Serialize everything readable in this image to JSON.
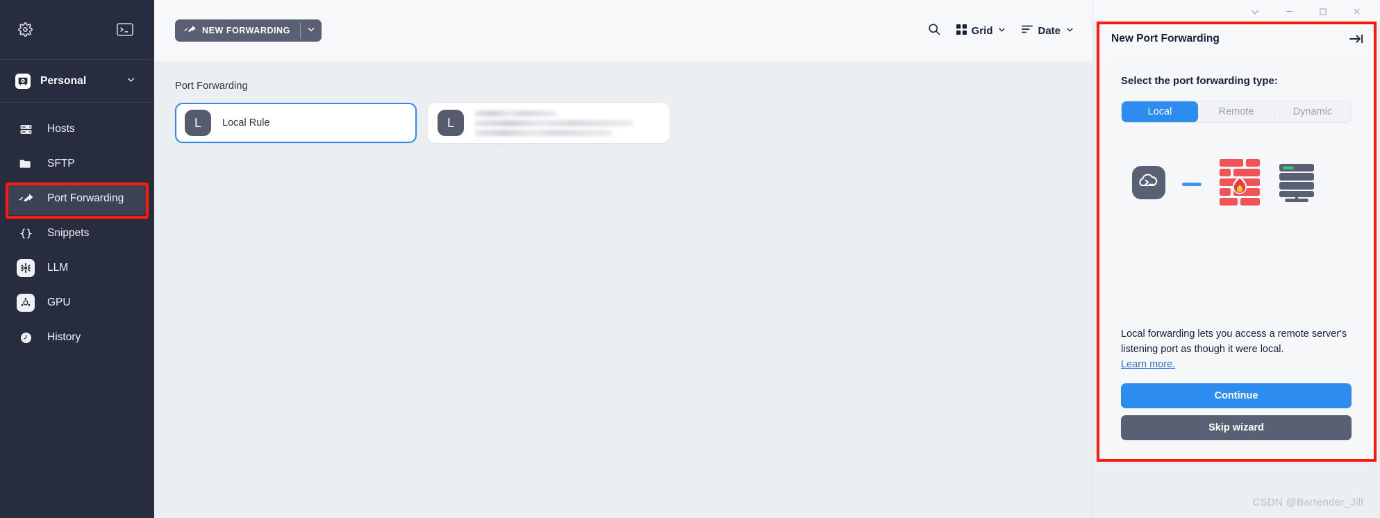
{
  "sidebar": {
    "settings_icon": "gear-icon",
    "terminal_icon": "terminal-icon",
    "workspace": {
      "label": "Personal",
      "icon": "vault-icon",
      "caret": "chevron-down-icon"
    },
    "items": [
      {
        "label": "Hosts",
        "icon": "server-rack-icon",
        "active": false,
        "badged": false
      },
      {
        "label": "SFTP",
        "icon": "folder-icon",
        "active": false,
        "badged": false
      },
      {
        "label": "Port Forwarding",
        "icon": "forward-arrows-icon",
        "active": true,
        "badged": false
      },
      {
        "label": "Snippets",
        "icon": "braces-icon",
        "active": false,
        "badged": false
      },
      {
        "label": "LLM",
        "icon": "llm-chip-icon",
        "active": false,
        "badged": true
      },
      {
        "label": "GPU",
        "icon": "gpu-icon",
        "active": false,
        "badged": true
      },
      {
        "label": "History",
        "icon": "clock-icon",
        "active": false,
        "badged": false
      }
    ]
  },
  "toolbar": {
    "new_forwarding_label": "NEW FORWARDING",
    "new_forwarding_icon": "forward-arrows-icon",
    "new_forwarding_caret": "chevron-down-icon",
    "search_icon": "search-icon",
    "view_label": "Grid",
    "view_icon": "grid-icon",
    "view_caret": "chevron-down-icon",
    "sort_label": "Date",
    "sort_icon": "sort-lines-icon",
    "sort_caret": "chevron-down-icon"
  },
  "main": {
    "section_title": "Port Forwarding",
    "cards": [
      {
        "avatar": "L",
        "title": "Local Rule",
        "selected": true,
        "redacted": false
      },
      {
        "avatar": "L",
        "title": "",
        "selected": false,
        "redacted": true
      }
    ],
    "watermark": "CSDN @Bartender_Jill"
  },
  "window_controls": {
    "chevron": "chevron-down-icon",
    "minimize": "minimize-icon",
    "maximize": "maximize-icon",
    "close": "close-icon"
  },
  "panel": {
    "title": "New Port Forwarding",
    "collapse_icon": "collapse-right-icon",
    "prompt": "Select the port forwarding type:",
    "tabs": [
      {
        "label": "Local",
        "active": true
      },
      {
        "label": "Remote",
        "active": false
      },
      {
        "label": "Dynamic",
        "active": false
      }
    ],
    "illustration": {
      "client_icon": "terminal-cloud-icon",
      "link_icon": "dash-connector",
      "firewall_icon": "firewall-brick-flame-icon",
      "server_icon": "server-stack-icon"
    },
    "description": "Local forwarding lets you access a remote server's listening port as though it were local.",
    "learn_more": "Learn more.",
    "primary_button": "Continue",
    "secondary_button": "Skip wizard"
  },
  "colors": {
    "sidebar_bg": "#272C3E",
    "sidebar_active": "#3C4256",
    "content_bg": "#ECEFF1",
    "toolbar_bg": "#F7F8FA",
    "accent_blue": "#2D8CF0",
    "slate": "#5A6073",
    "firewall_red": "#F05458",
    "highlight_red": "#FF1A0E",
    "status_green": "#2ECC71"
  }
}
